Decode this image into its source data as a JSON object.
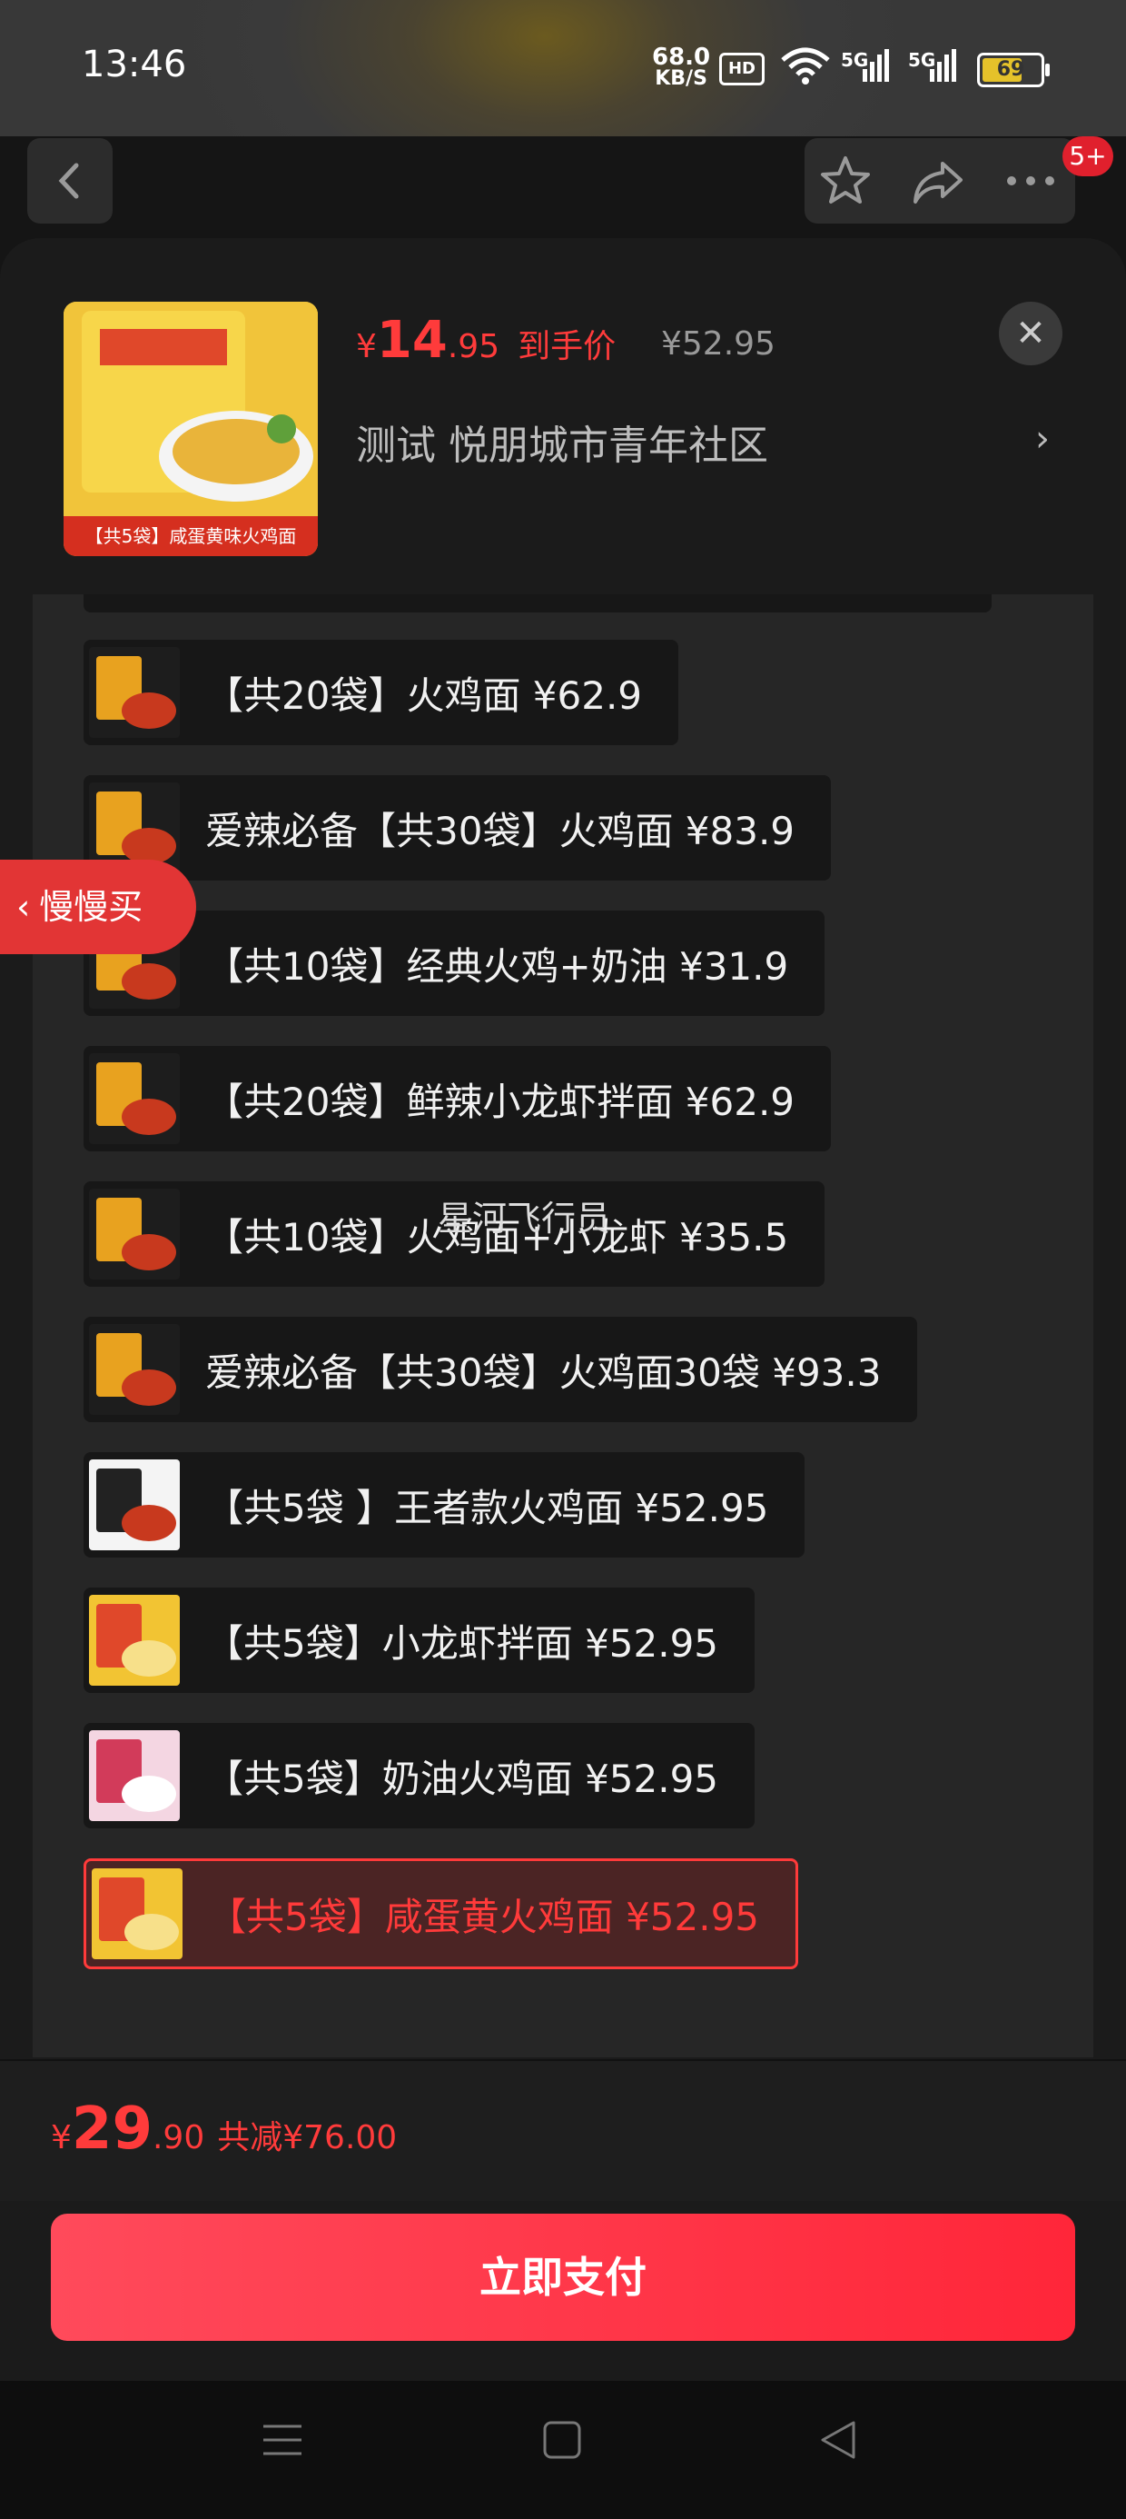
{
  "status_bar": {
    "time": "13:46",
    "net_speed_value": "68.0",
    "net_speed_unit": "KB/S",
    "hd_label": "HD",
    "signal_1_label": "5G",
    "signal_2_label": "5G",
    "battery_level": 69,
    "battery_text": "69"
  },
  "top_nav": {
    "notification_count": "5+"
  },
  "product": {
    "thumb_caption": "【共5袋】咸蛋黄味火鸡面",
    "price_symbol": "¥",
    "price_int": "14",
    "price_dec": ".95",
    "price_label": "到手价",
    "original_price": "¥52.95",
    "address": "测试  悦朋城市青年社区"
  },
  "side_tab": {
    "label": "慢慢买"
  },
  "watermark": "星河飞行员",
  "variants": [
    {
      "label": "【共20袋】火鸡面  ¥62.9",
      "selected": false,
      "thumb": "dark"
    },
    {
      "label": "爱辣必备【共30袋】火鸡面  ¥83.9",
      "selected": false,
      "thumb": "dark"
    },
    {
      "label": "【共10袋】经典火鸡+奶油  ¥31.9",
      "selected": false,
      "thumb": "dark"
    },
    {
      "label": "【共20袋】鲜辣小龙虾拌面  ¥62.9",
      "selected": false,
      "thumb": "dark"
    },
    {
      "label": "【共10袋】火鸡面+小龙虾  ¥35.5",
      "selected": false,
      "thumb": "dark"
    },
    {
      "label": "爱辣必备【共30袋】火鸡面30袋  ¥93.3",
      "selected": false,
      "thumb": "dark"
    },
    {
      "label": "【共5袋 】王者款火鸡面  ¥52.95",
      "selected": false,
      "thumb": "white"
    },
    {
      "label": "【共5袋】小龙虾拌面  ¥52.95",
      "selected": false,
      "thumb": "yellow"
    },
    {
      "label": "【共5袋】奶油火鸡面  ¥52.95",
      "selected": false,
      "thumb": "pink"
    },
    {
      "label": "【共5袋】咸蛋黄火鸡面  ¥52.95",
      "selected": true,
      "thumb": "yellow"
    }
  ],
  "bottom": {
    "price_symbol": "¥",
    "price_int": "29",
    "price_dec": ".90",
    "discount": "共减¥76.00",
    "pay_button": "立即支付"
  },
  "colors": {
    "accent": "#ff3b3b",
    "sheet_bg": "#1b1b1b",
    "panel_bg": "#262626",
    "chip_bg": "#171717"
  }
}
